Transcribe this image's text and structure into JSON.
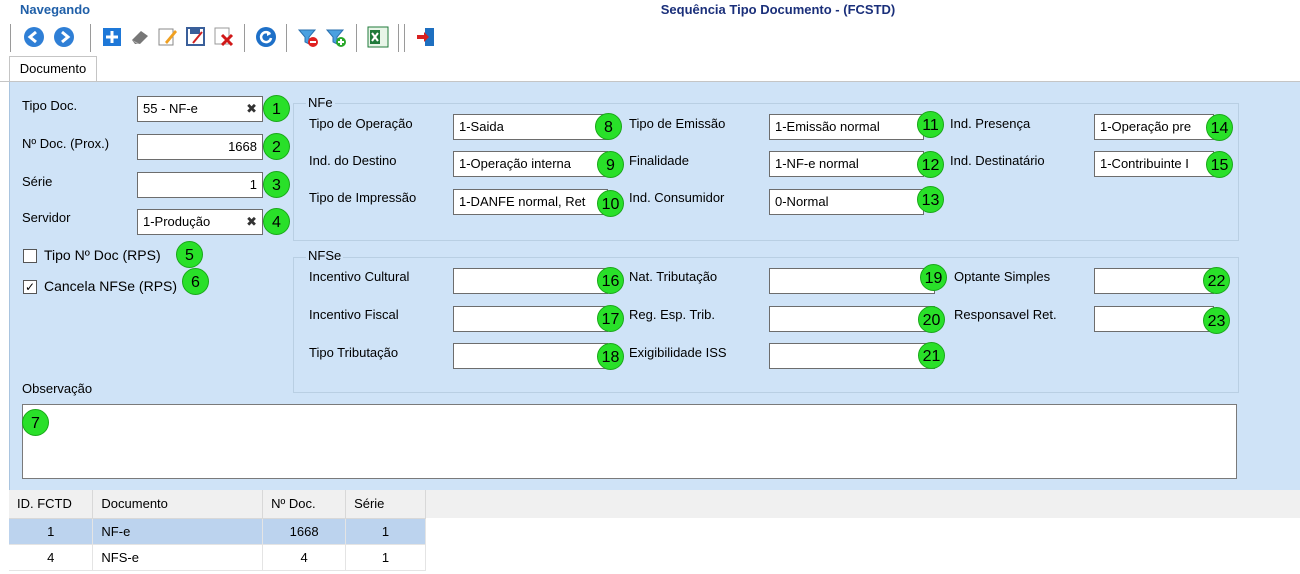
{
  "header": {
    "status": "Navegando",
    "title": "Sequência Tipo Documento - (FCSTD)"
  },
  "toolbar": [
    {
      "name": "back-icon"
    },
    {
      "name": "forward-icon"
    },
    {
      "name": "add-icon"
    },
    {
      "name": "eraser-icon"
    },
    {
      "name": "edit-icon"
    },
    {
      "name": "save-icon"
    },
    {
      "name": "delete-icon"
    },
    {
      "name": "refresh-icon"
    },
    {
      "name": "filter-remove-icon"
    },
    {
      "name": "filter-add-icon"
    },
    {
      "name": "excel-icon"
    },
    {
      "name": "exit-icon"
    }
  ],
  "tabs": {
    "documento": "Documento"
  },
  "left": {
    "tipo_doc_label": "Tipo Doc.",
    "tipo_doc_value": "55 - NF-e",
    "num_doc_label": "Nº Doc. (Prox.)",
    "num_doc_value": "1668",
    "serie_label": "Série",
    "serie_value": "1",
    "servidor_label": "Servidor",
    "servidor_value": "1-Produção",
    "tipo_num_rps_label": "Tipo Nº Doc (RPS)",
    "tipo_num_rps_checked": false,
    "cancela_nfse_label": "Cancela NFSe (RPS)",
    "cancela_nfse_checked": true,
    "observacao_label": "Observação",
    "clear_glyph": "✖",
    "check_glyph": "✓"
  },
  "nfe": {
    "group_title": "NFe",
    "tipo_operacao_label": "Tipo de Operação",
    "tipo_operacao_value": "1-Saida",
    "ind_destino_label": "Ind. do Destino",
    "ind_destino_value": "1-Operação interna",
    "tipo_impressao_label": "Tipo de Impressão",
    "tipo_impressao_value": "1-DANFE normal, Ret",
    "tipo_emissao_label": "Tipo de Emissão",
    "tipo_emissao_value": "1-Emissão normal",
    "finalidade_label": "Finalidade",
    "finalidade_value": "1-NF-e normal",
    "ind_consumidor_label": "Ind. Consumidor",
    "ind_consumidor_value": "0-Normal",
    "ind_presenca_label": "Ind. Presença",
    "ind_presenca_value": "1-Operação pre",
    "ind_destinatario_label": "Ind. Destinatário",
    "ind_destinatario_value": "1-Contribuinte I"
  },
  "nfse": {
    "group_title": "NFSe",
    "incentivo_cultural_label": "Incentivo Cultural",
    "incentivo_fiscal_label": "Incentivo Fiscal",
    "tipo_tributacao_label": "Tipo Tributação",
    "nat_tributacao_label": "Nat. Tributação",
    "reg_esp_trib_label": "Reg. Esp. Trib.",
    "exigibilidade_iss_label": "Exigibilidade ISS",
    "optante_simples_label": "Optante Simples",
    "responsavel_ret_label": "Responsavel Ret."
  },
  "markers": [
    "1",
    "2",
    "3",
    "4",
    "5",
    "6",
    "7",
    "8",
    "9",
    "10",
    "11",
    "12",
    "13",
    "14",
    "15",
    "16",
    "17",
    "18",
    "19",
    "20",
    "21",
    "22",
    "23"
  ],
  "grid": {
    "columns": [
      "ID. FCTD",
      "Documento",
      "Nº Doc.",
      "Série"
    ],
    "rows": [
      {
        "id": "1",
        "documento": "NF-e",
        "num_doc": "1668",
        "serie": "1",
        "selected": true
      },
      {
        "id": "4",
        "documento": "NFS-e",
        "num_doc": "4",
        "serie": "1",
        "selected": false
      }
    ]
  },
  "colors": {
    "marker": "#29e029",
    "panel": "#cfe3f7",
    "status": "#1f5fa8",
    "title": "#1a2f7a",
    "selected_row": "#bcd3ee"
  }
}
